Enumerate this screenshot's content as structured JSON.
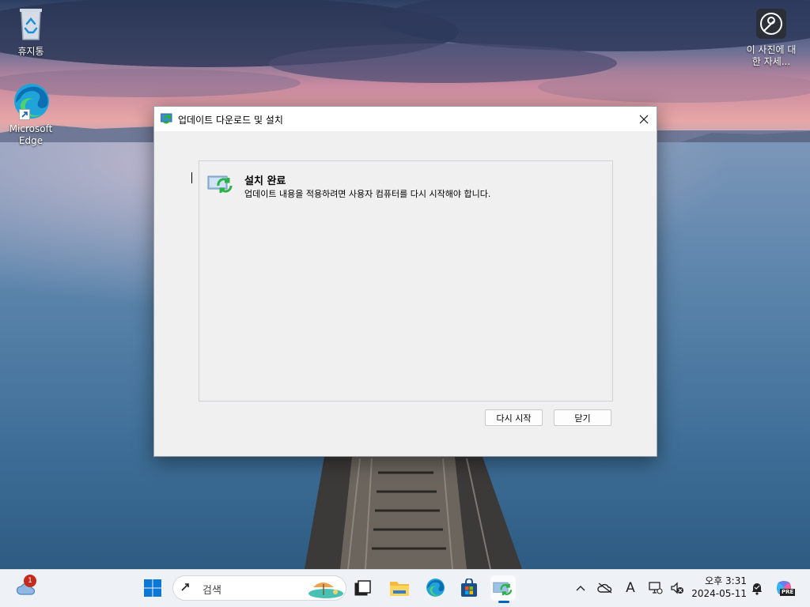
{
  "desktop": {
    "icons": [
      {
        "label": "휴지통",
        "icon": "recycle-bin-icon"
      },
      {
        "label": "Microsoft Edge",
        "icon": "edge-shortcut-icon"
      },
      {
        "label": "이 사진에 대한 자세...",
        "icon": "about-picture-icon"
      }
    ]
  },
  "dialog": {
    "title": "업데이트 다운로드 및 설치",
    "status_title": "설치 완료",
    "status_description": "업데이트 내용을 적용하려면 사용자 컴퓨터를 다시 시작해야 합니다.",
    "restart_label": "다시 시작",
    "close_label": "닫기"
  },
  "taskbar": {
    "weather_badge": "1",
    "search_placeholder": "검색",
    "clock_time": "오후 3:31",
    "clock_date": "2024-05-11",
    "ime_indicator": "A",
    "copilot_badge": "PRE",
    "accent_color": "#0067c0"
  }
}
